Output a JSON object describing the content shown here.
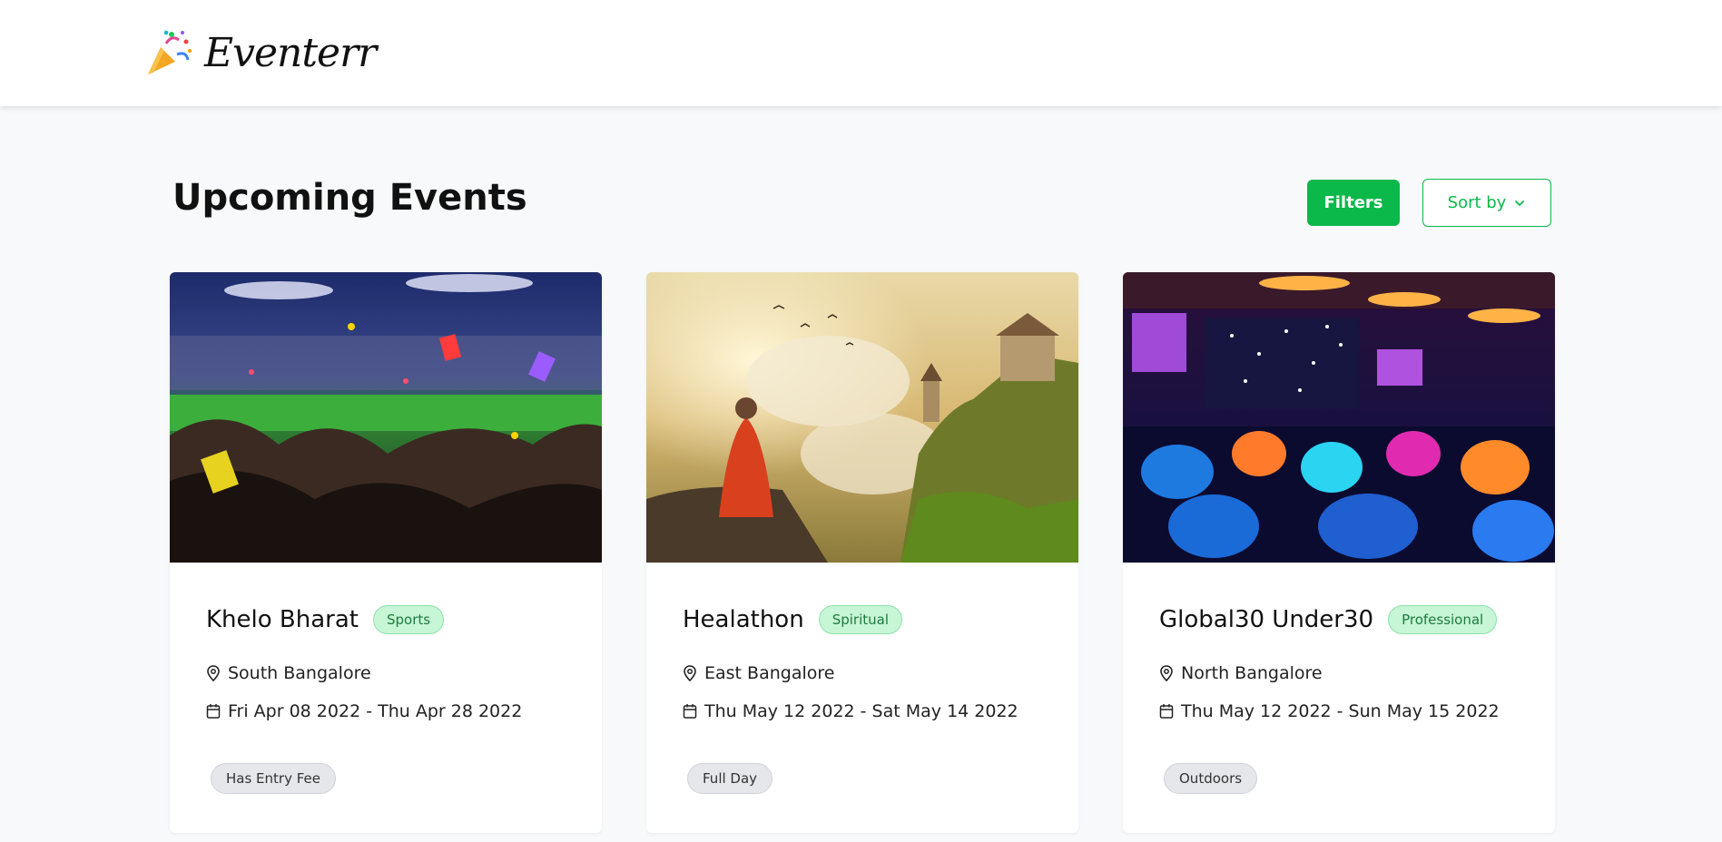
{
  "header": {
    "brand": "Eventerr",
    "logo_icon": "party-popper-icon"
  },
  "main": {
    "title": "Upcoming Events",
    "filters_label": "Filters",
    "sort_label": "Sort by",
    "accent_color": "#0bb84a"
  },
  "events": [
    {
      "title": "Khelo Bharat",
      "category": "Sports",
      "location": "South Bangalore",
      "dates": "Fri Apr 08 2022 - Thu Apr 28 2022",
      "tag": "Has Entry Fee",
      "image": "stadium crowd cheering with confetti"
    },
    {
      "title": "Healathon",
      "category": "Spiritual",
      "location": "East Bangalore",
      "dates": "Thu May 12 2022 - Sat May 14 2022",
      "tag": "Full Day",
      "image": "monk meditating on cliff facing castle"
    },
    {
      "title": "Global30 Under30",
      "category": "Professional",
      "location": "North Bangalore",
      "dates": "Thu May 12 2022 - Sun May 15 2022",
      "tag": "Outdoors",
      "image": "banquet hall with colorful lights"
    }
  ]
}
